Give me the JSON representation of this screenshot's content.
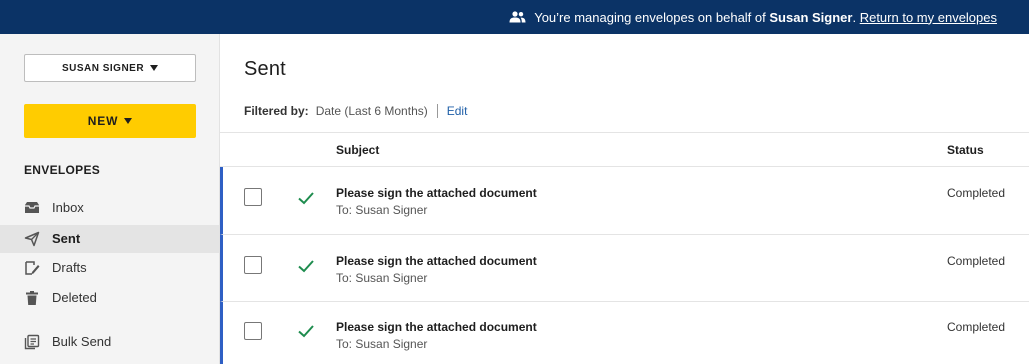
{
  "banner": {
    "prefix": "You’re managing envelopes on behalf of ",
    "user": "Susan Signer",
    "suffix": ".",
    "return_link": "Return to my envelopes",
    "bg_color": "#0b3366"
  },
  "sidebar": {
    "account_button": "SUSAN SIGNER",
    "new_button": "NEW",
    "section_label": "ENVELOPES",
    "items": [
      {
        "label": "Inbox",
        "icon": "inbox-icon",
        "active": false
      },
      {
        "label": "Sent",
        "icon": "send-icon",
        "active": true
      },
      {
        "label": "Drafts",
        "icon": "drafts-icon",
        "active": false
      },
      {
        "label": "Deleted",
        "icon": "trash-icon",
        "active": false
      },
      {
        "label": "Bulk Send",
        "icon": "bulk-send-icon",
        "active": false
      }
    ],
    "accent_color": "#ffcc00"
  },
  "main": {
    "title": "Sent",
    "filter": {
      "label": "Filtered by:",
      "value": "Date (Last 6 Months)",
      "edit": "Edit"
    },
    "columns": {
      "subject": "Subject",
      "status": "Status"
    },
    "rows": [
      {
        "subject": "Please sign the attached document",
        "to": "To: Susan Signer",
        "status": "Completed"
      },
      {
        "subject": "Please sign the attached document",
        "to": "To: Susan Signer",
        "status": "Completed"
      },
      {
        "subject": "Please sign the attached document",
        "to": "To: Susan Signer",
        "status": "Completed"
      }
    ],
    "row_accent_color": "#2e5fc4",
    "check_color": "#1e8c4e"
  }
}
